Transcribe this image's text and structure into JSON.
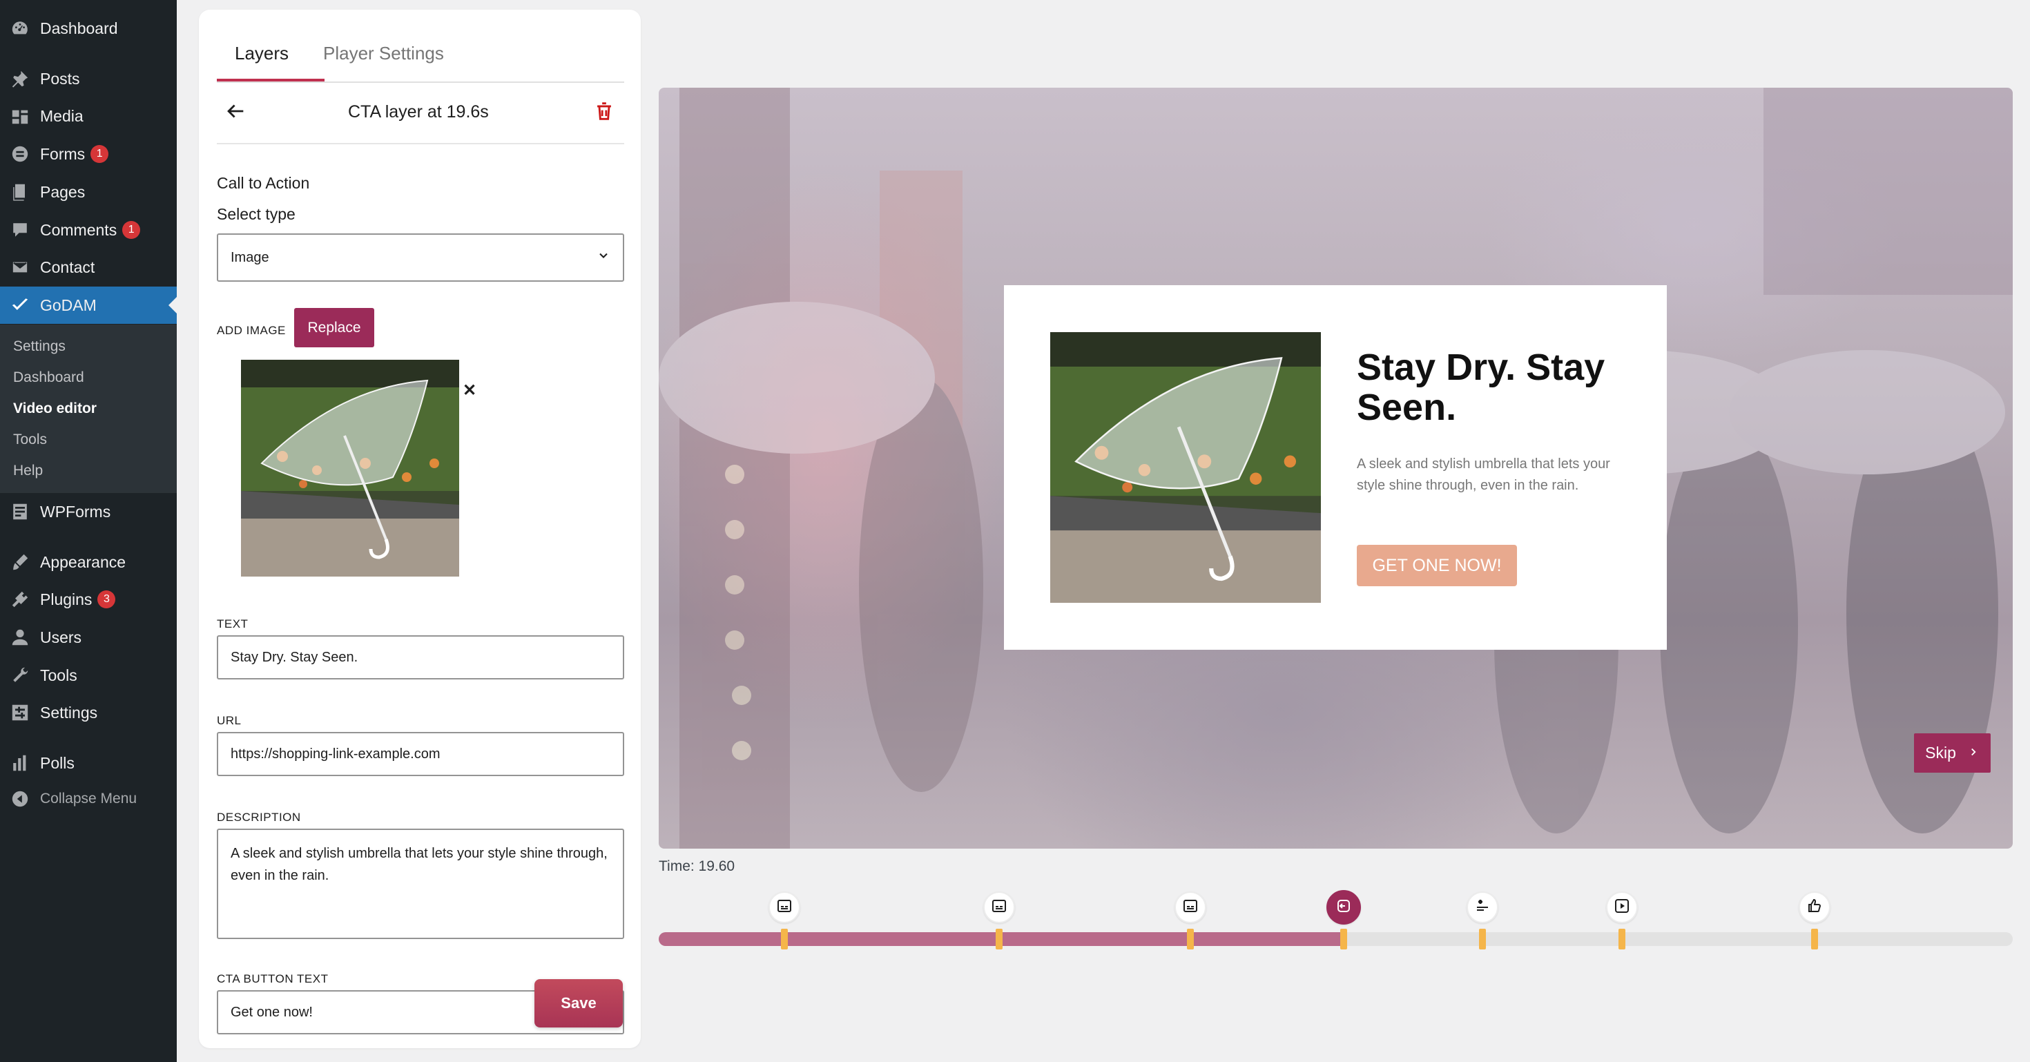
{
  "admin_menu": {
    "items": [
      {
        "label": "Dashboard",
        "icon": "dashboard-icon"
      },
      {
        "label": "Posts",
        "icon": "pin-icon"
      },
      {
        "label": "Media",
        "icon": "media-icon"
      },
      {
        "label": "Forms",
        "icon": "forms-icon",
        "badge": "1"
      },
      {
        "label": "Pages",
        "icon": "pages-icon"
      },
      {
        "label": "Comments",
        "icon": "comments-icon",
        "badge": "1"
      },
      {
        "label": "Contact",
        "icon": "mail-icon"
      },
      {
        "label": "GoDAM",
        "icon": "godam-icon"
      },
      {
        "label": "WPForms",
        "icon": "wpforms-icon"
      },
      {
        "label": "Appearance",
        "icon": "appearance-icon"
      },
      {
        "label": "Plugins",
        "icon": "plugins-icon",
        "badge": "3"
      },
      {
        "label": "Users",
        "icon": "users-icon"
      },
      {
        "label": "Tools",
        "icon": "tools-icon"
      },
      {
        "label": "Settings",
        "icon": "settings-icon"
      },
      {
        "label": "Polls",
        "icon": "polls-icon"
      },
      {
        "label": "Collapse Menu",
        "icon": "collapse-icon"
      }
    ],
    "submenu": [
      "Settings",
      "Dashboard",
      "Video editor",
      "Tools",
      "Help"
    ]
  },
  "panel": {
    "tabs": [
      "Layers",
      "Player Settings"
    ],
    "layer_title": "CTA layer at 19.6s",
    "section_title": "Call to Action",
    "select_type_label": "Select type",
    "select_type_value": "Image",
    "add_image_label": "ADD IMAGE",
    "replace_label": "Replace",
    "text_label": "TEXT",
    "text_value": "Stay Dry. Stay Seen.",
    "url_label": "URL",
    "url_value": "https://shopping-link-example.com",
    "description_label": "DESCRIPTION",
    "description_value": "A sleek and stylish umbrella that lets your style shine through, even in the rain.",
    "cta_button_text_label": "CTA BUTTON TEXT",
    "cta_button_text_value": "Get one now!",
    "save_label": "Save"
  },
  "preview": {
    "cta_heading": "Stay Dry. Stay Seen.",
    "cta_description": "A sleek and stylish umbrella that lets your style shine through, even in the rain.",
    "cta_button": "GET ONE NOW!",
    "skip_label": "Skip",
    "time_label": "Time: 19.60"
  },
  "timeline": {
    "progress_fraction": 0.506,
    "markers": [
      {
        "icon": "subtitle-icon"
      },
      {
        "icon": "subtitle-icon"
      },
      {
        "icon": "subtitle-icon"
      },
      {
        "icon": "cta-icon",
        "active": true
      },
      {
        "icon": "form-icon"
      },
      {
        "icon": "video-icon"
      },
      {
        "icon": "thumbs-up-icon"
      }
    ]
  },
  "colors": {
    "accent": "#9b2b59",
    "admin_bg": "#1d2327",
    "admin_active": "#2271b1",
    "cta_button_bg": "#e8a98e",
    "marker": "#f5b54a"
  }
}
